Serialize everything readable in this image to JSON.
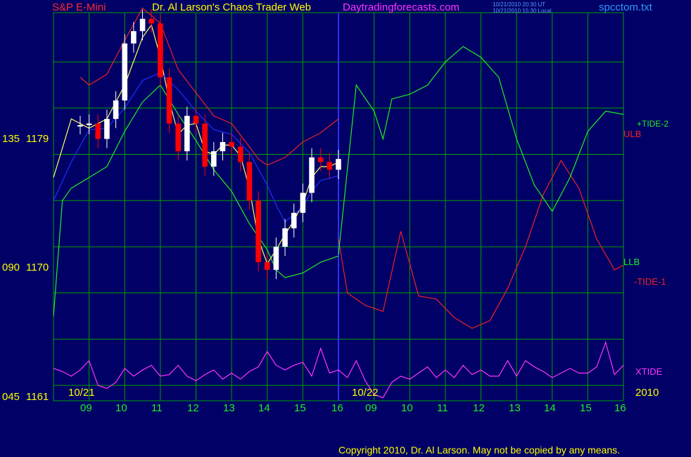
{
  "header": {
    "symbol": "S&P E-Mini",
    "title": "Dr. Al Larson's Chaos Trader Web",
    "site": "Daytradingforecasts.com",
    "time_ut": "10/21/2010 20:30 UT",
    "time_local": "10/21/2010 15:30 Local",
    "file": "spcctom.txt"
  },
  "footer": {
    "copyright": "Copyright 2010, Dr. Al Larson. May not be copied by any means."
  },
  "colors": {
    "background": "#000066",
    "grid": "#00a000",
    "symbol": "#ff2a2a",
    "title": "#ffff00",
    "site": "#ff33ff",
    "file": "#3399ff",
    "price_up": "#ffffff",
    "price_down": "#ff0000",
    "ma_fast": "#ffff66",
    "ma_slow": "#1f2fff",
    "tide_plus": "#22ee22",
    "tide_minus": "#ee2222",
    "xtide": "#ff33ff",
    "cursor": "#3030ff"
  },
  "chart_data": {
    "type": "line",
    "title": "S&P E-Mini",
    "y_price_ticks": [
      1161,
      1170,
      1179
    ],
    "y_code_ticks": [
      "045",
      "090",
      "135"
    ],
    "ylim": [
      1161,
      1179
    ],
    "x_hour_labels": [
      "09",
      "10",
      "11",
      "12",
      "13",
      "14",
      "15",
      "16",
      "09",
      "10",
      "11",
      "12",
      "13",
      "14",
      "15",
      "16"
    ],
    "date_labels": [
      "10/21",
      "10/22"
    ],
    "year_label": "2010",
    "grid": true,
    "series": [
      {
        "name": "S&P E-Mini",
        "kind": "price",
        "x": [
          8.75,
          9.0,
          9.25,
          9.5,
          9.75,
          10.0,
          10.25,
          10.5,
          10.75,
          11.0,
          11.25,
          11.5,
          11.75,
          12.0,
          12.25,
          12.5,
          12.75,
          13.0,
          13.25,
          13.5,
          13.75,
          14.0,
          14.25,
          14.5,
          14.75,
          15.0,
          15.25,
          15.5,
          15.75,
          16.0
        ],
        "values": [
          1178.9,
          1179.0,
          1178.0,
          1179.3,
          1180.5,
          1184.2,
          1185.0,
          1185.8,
          1185.5,
          1182.0,
          1179.0,
          1177.2,
          1179.5,
          1179.0,
          1176.2,
          1177.2,
          1177.8,
          1177.5,
          1176.5,
          1174.0,
          1170.0,
          1169.5,
          1171.0,
          1172.2,
          1173.2,
          1174.5,
          1176.8,
          1176.5,
          1176.0,
          1176.7
        ]
      },
      {
        "name": "ULB",
        "kind": "tide_minus",
        "x": [
          8.75,
          9.0,
          9.5,
          10.0,
          10.5,
          11.0,
          11.5,
          12.0,
          12.5,
          13.0,
          13.5,
          13.75,
          14.0,
          14.5,
          15.0,
          15.5,
          16.0
        ],
        "values": [
          1182,
          1181.5,
          1182.2,
          1184.4,
          1186.5,
          1185.5,
          1182.5,
          1181.0,
          1179.5,
          1179.0,
          1177.5,
          1176.7,
          1176.3,
          1176.8,
          1177.8,
          1178.4,
          1179.3
        ]
      },
      {
        "name": "-TIDE-1",
        "kind": "tide_minus",
        "x": [
          16.0,
          16.25,
          16.75,
          17.25,
          17.75,
          18.25,
          18.75,
          19.25,
          19.75,
          20.25,
          20.75,
          21.25,
          21.75,
          22.25,
          22.75,
          23.25,
          23.75,
          24.0
        ],
        "values": [
          1171.5,
          1168.0,
          1167.2,
          1166.8,
          1172.0,
          1167.8,
          1167.6,
          1166.4,
          1165.7,
          1166.2,
          1168.3,
          1171.0,
          1174.4,
          1176.6,
          1174.8,
          1171.5,
          1169.5,
          1169.8
        ]
      },
      {
        "name": "+TIDE-2",
        "kind": "tide_plus",
        "x": [
          16.0,
          16.5,
          17.0,
          17.25,
          17.5,
          18.0,
          18.5,
          19.0,
          19.5,
          20.0,
          20.5,
          21.0,
          21.5,
          22.0,
          22.5,
          23.0,
          23.5,
          24.0
        ],
        "values": [
          1170.5,
          1181.5,
          1179.8,
          1178.0,
          1180.6,
          1180.9,
          1181.5,
          1183.0,
          1184.0,
          1183.3,
          1182.0,
          1178.0,
          1175.0,
          1173.3,
          1175.5,
          1178.5,
          1179.8,
          1179.6
        ]
      },
      {
        "name": "LLB",
        "kind": "tide_plus",
        "x": [
          8.0,
          8.25,
          8.5,
          9.0,
          9.5,
          10.0,
          10.5,
          11.0,
          11.5,
          12.0,
          12.5,
          13.0,
          13.5,
          14.0,
          14.25,
          14.5,
          15.0,
          15.5,
          16.0
        ],
        "values": [
          1166.5,
          1174.0,
          1174.8,
          1175.5,
          1176.2,
          1178.5,
          1180.4,
          1181.5,
          1179.6,
          1177.9,
          1176.0,
          1174.6,
          1172.5,
          1170.8,
          1169.5,
          1169.0,
          1169.3,
          1170.0,
          1170.4
        ]
      },
      {
        "name": "XTIDE",
        "kind": "xtide",
        "x": [
          8.0,
          8.25,
          8.5,
          8.75,
          9.0,
          9.25,
          9.5,
          9.75,
          10.0,
          10.25,
          10.5,
          10.75,
          11.0,
          11.25,
          11.5,
          11.75,
          12.0,
          12.25,
          12.5,
          12.75,
          13.0,
          13.25,
          13.5,
          13.75,
          14.0,
          14.25,
          14.5,
          14.75,
          15.0,
          15.25,
          15.5,
          15.75,
          16.0,
          16.25,
          16.5,
          16.75,
          17.0,
          17.25,
          17.5,
          17.75,
          18.0,
          18.25,
          18.5,
          18.75,
          19.0,
          19.25,
          19.5,
          19.75,
          20.0,
          20.25,
          20.5,
          20.75,
          21.0,
          21.25,
          21.5,
          21.75,
          22.0,
          22.25,
          22.5,
          22.75,
          23.0,
          23.25,
          23.5,
          23.75,
          24.0
        ],
        "values": [
          1163.1,
          1162.9,
          1162.6,
          1163.0,
          1163.6,
          1162.0,
          1161.8,
          1162.2,
          1163.1,
          1162.6,
          1163.0,
          1163.3,
          1162.6,
          1162.7,
          1163.3,
          1162.6,
          1162.3,
          1162.7,
          1163.0,
          1162.4,
          1162.8,
          1162.4,
          1162.9,
          1163.2,
          1164.2,
          1163.3,
          1163.0,
          1163.3,
          1163.5,
          1162.6,
          1164.4,
          1162.8,
          1163.0,
          1162.5,
          1163.6,
          1162.3,
          1161.4,
          1161.2,
          1162.2,
          1162.6,
          1162.4,
          1162.8,
          1163.2,
          1162.5,
          1163.0,
          1162.5,
          1163.3,
          1162.7,
          1163.0,
          1162.6,
          1162.6,
          1163.6,
          1162.6,
          1163.6,
          1163.2,
          1162.9,
          1162.5,
          1162.8,
          1163.1,
          1162.8,
          1162.8,
          1163.2,
          1164.8,
          1162.7,
          1163.3
        ]
      },
      {
        "name": "fast-average",
        "kind": "ma_fast",
        "x": [
          8.0,
          8.5,
          9.0,
          9.5,
          10.0,
          10.5,
          10.75,
          11.0,
          11.25,
          11.5,
          11.75,
          12.0,
          12.25,
          12.5,
          12.75,
          13.0,
          13.25,
          13.5,
          13.75,
          14.0,
          14.25,
          14.5,
          14.75,
          15.0,
          15.25,
          15.5,
          15.75,
          16.0
        ],
        "values": [
          1175.5,
          1179.3,
          1178.7,
          1179.3,
          1181.5,
          1184.6,
          1185.4,
          1183.3,
          1180.5,
          1178.3,
          1178.9,
          1179.0,
          1177.2,
          1177.0,
          1177.6,
          1177.6,
          1176.9,
          1174.8,
          1171.5,
          1169.9,
          1170.8,
          1171.8,
          1172.7,
          1173.8,
          1175.5,
          1176.2,
          1176.2,
          1176.5
        ]
      },
      {
        "name": "slow-average",
        "kind": "ma_slow",
        "x": [
          8.0,
          8.5,
          9.0,
          9.5,
          10.0,
          10.5,
          11.0,
          11.5,
          12.0,
          12.5,
          13.0,
          13.5,
          14.0,
          14.25,
          14.5,
          15.0,
          15.25,
          15.5,
          16.0
        ],
        "values": [
          1174.0,
          1176.5,
          1178.6,
          1178.7,
          1180.0,
          1181.8,
          1182.3,
          1181.2,
          1179.8,
          1178.6,
          1178.3,
          1177.1,
          1175.0,
          1173.7,
          1172.6,
          1173.6,
          1174.6,
          1175.3,
          1175.6
        ]
      }
    ],
    "annotations": [
      "+TIDE-2",
      "ULB",
      "LLB",
      "-TIDE-1",
      "XTIDE"
    ]
  }
}
